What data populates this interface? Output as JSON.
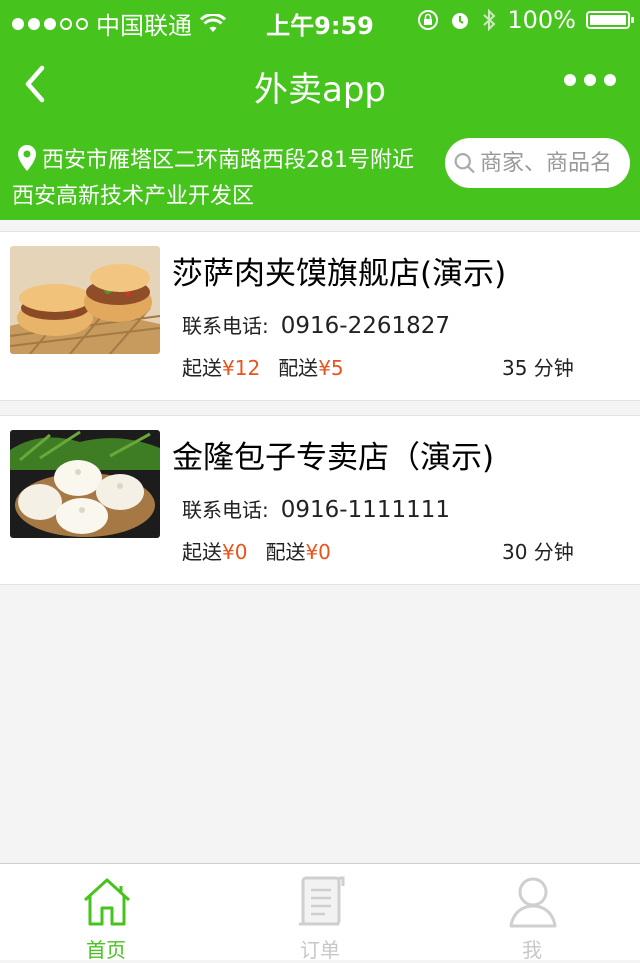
{
  "status_bar": {
    "carrier": "中国联通",
    "time": "上午9:59",
    "battery": "100%",
    "battery_level": 1.0
  },
  "nav": {
    "title": "外卖app",
    "back_icon": "chevron-left-icon",
    "more_icon": "more-dots-icon"
  },
  "location": {
    "line1": "西安市雁塔区二环南路西段281号附近",
    "line2": "西安高新技术产业开发区",
    "icon": "location-pin-icon"
  },
  "search": {
    "placeholder": "商家、商品名"
  },
  "stores": [
    {
      "name": "莎萨肉夹馍旗舰店(演示)",
      "phone_label": "联系电话:",
      "phone": "0916-2261827",
      "min_label": "起送",
      "min_value": "¥12",
      "delivery_label": "配送",
      "delivery_value": "¥5",
      "eta": "35 分钟"
    },
    {
      "name": "金隆包子专卖店（演示)",
      "phone_label": "联系电话:",
      "phone": "0916-1111111",
      "min_label": "起送",
      "min_value": "¥0",
      "delivery_label": "配送",
      "delivery_value": "¥0",
      "eta": "30 分钟"
    }
  ],
  "tabs": [
    {
      "label": "首页",
      "icon": "home-icon",
      "active": true
    },
    {
      "label": "订单",
      "icon": "order-list-icon",
      "active": false
    },
    {
      "label": "我",
      "icon": "user-icon",
      "active": false
    }
  ],
  "colors": {
    "brand_green": "#46c31d",
    "price_orange": "#e8541c",
    "inactive_gray": "#c8c8c8"
  }
}
